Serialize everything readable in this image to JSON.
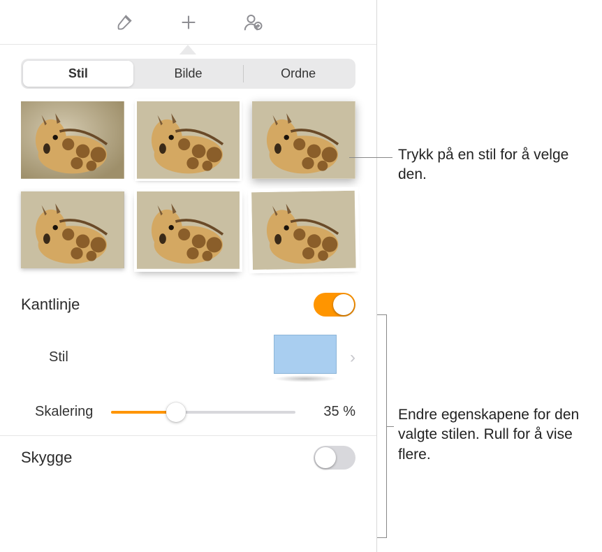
{
  "toolbar": {
    "icons": [
      "brush-icon",
      "add-icon",
      "person-plus-icon"
    ]
  },
  "tabs": {
    "items": [
      "Stil",
      "Bilde",
      "Ordne"
    ],
    "activeIndex": 0
  },
  "border": {
    "label": "Kantlinje",
    "enabled": true,
    "style_label": "Stil",
    "scale_label": "Skalering",
    "scale_value": "35 %",
    "scale_percent": 35
  },
  "shadow": {
    "label": "Skygge",
    "enabled": false
  },
  "callouts": {
    "styleTap": "Trykk på en stil for å velge den.",
    "properties": "Endre egenskapene for den valgte stilen. Rull for å vise flere."
  },
  "chart_data": null
}
